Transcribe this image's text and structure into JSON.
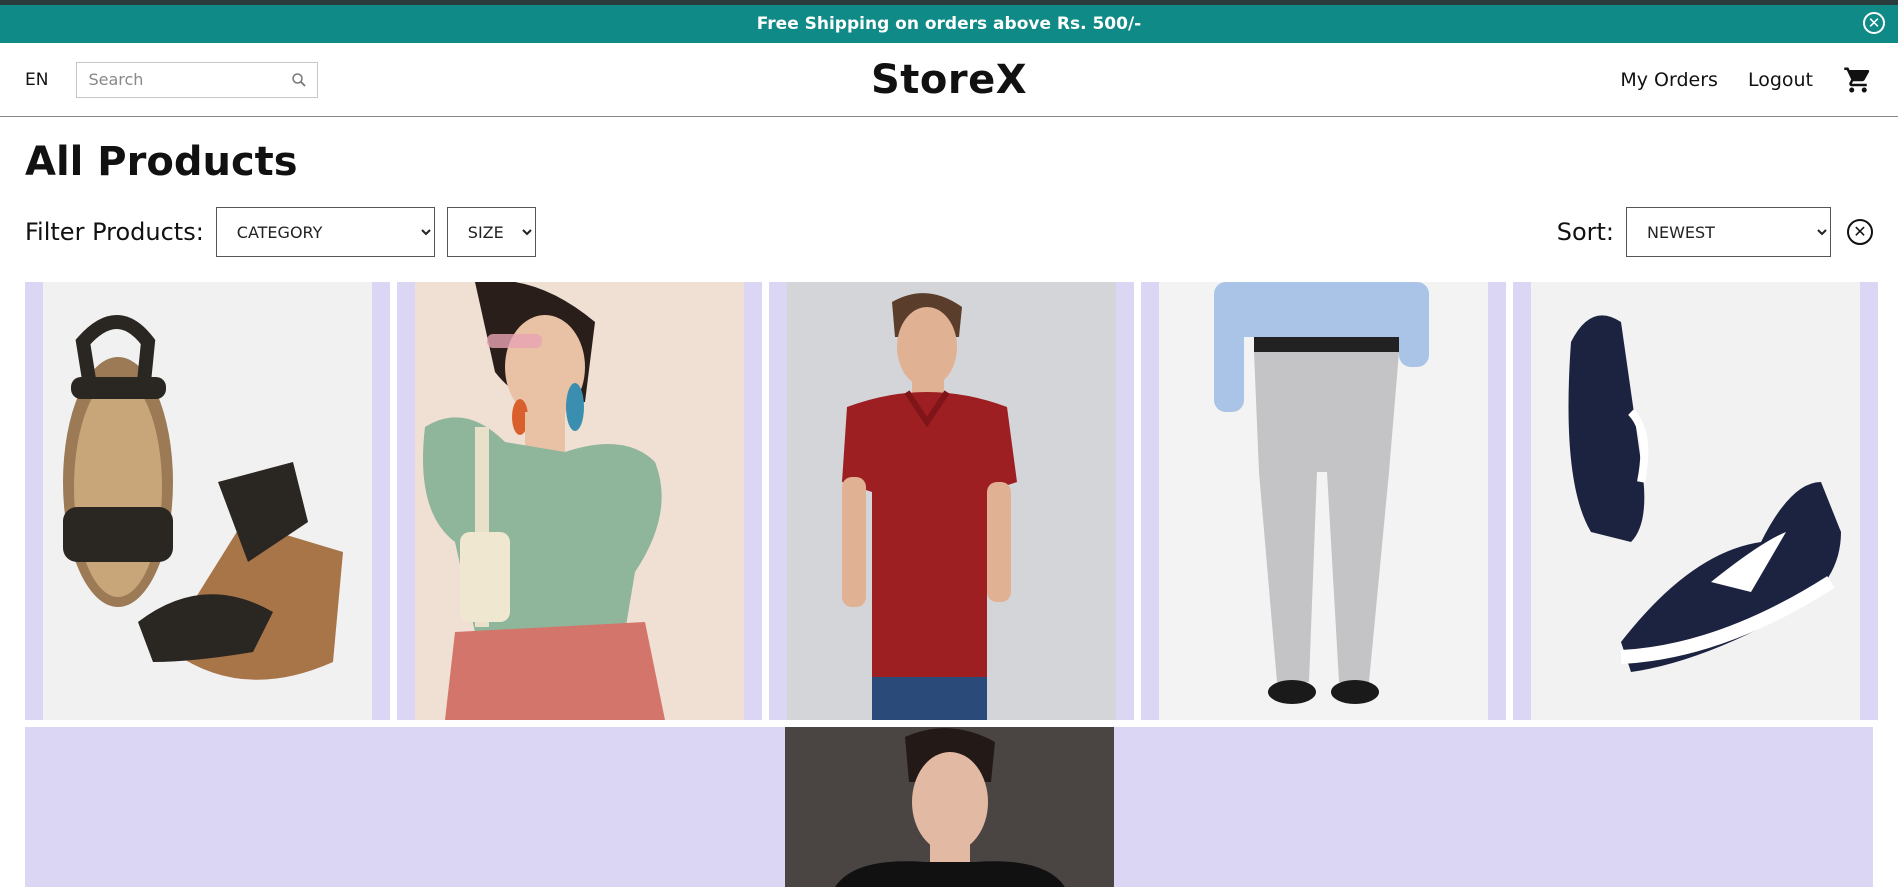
{
  "promo": {
    "text": "Free Shipping on orders above Rs. 500/-"
  },
  "header": {
    "language": "EN",
    "search": {
      "placeholder": "Search",
      "value": ""
    },
    "logo": "StoreX",
    "links": {
      "orders": "My Orders",
      "logout": "Logout"
    }
  },
  "main": {
    "title": "All Products",
    "filter_label": "Filter Products:",
    "category": {
      "selected": "CATEGORY"
    },
    "size": {
      "selected": "SIZE"
    },
    "sort_label": "Sort:",
    "sort": {
      "selected": "NEWEST"
    }
  },
  "colors": {
    "promo_bg": "#0f8a87",
    "card_bg": "#dcd6f5"
  },
  "products": [
    {
      "icon": "sandals-image"
    },
    {
      "icon": "woman-green-top-image"
    },
    {
      "icon": "man-red-polo-image"
    },
    {
      "icon": "grey-trousers-image"
    },
    {
      "icon": "navy-sneakers-image"
    },
    {
      "icon": "man-black-tshirt-image"
    }
  ]
}
